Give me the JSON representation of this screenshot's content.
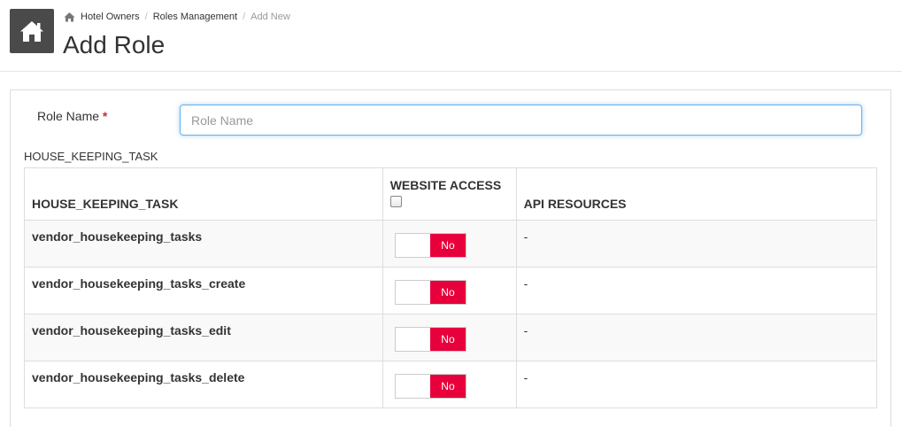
{
  "header": {
    "breadcrumb": [
      "Hotel Owners",
      "Roles Management",
      "Add New"
    ],
    "title": "Add Role"
  },
  "form": {
    "role_name_label": "Role Name",
    "required_marker": "*",
    "role_name_placeholder": "Role Name",
    "role_name_value": ""
  },
  "section": {
    "title": "HOUSE_KEEPING_TASK",
    "columns": [
      "HOUSE_KEEPING_TASK",
      "WEBSITE ACCESS",
      "API RESOURCES"
    ],
    "select_all_checked": false,
    "rows": [
      {
        "name": "vendor_housekeeping_tasks",
        "access": "No",
        "api": "-"
      },
      {
        "name": "vendor_housekeeping_tasks_create",
        "access": "No",
        "api": "-"
      },
      {
        "name": "vendor_housekeeping_tasks_edit",
        "access": "No",
        "api": "-"
      },
      {
        "name": "vendor_housekeeping_tasks_delete",
        "access": "No",
        "api": "-"
      }
    ]
  },
  "colors": {
    "toggle_off": "#e8003c",
    "home_tile": "#4a4a4a",
    "input_focus": "#66afe9",
    "required": "#c9302c"
  }
}
